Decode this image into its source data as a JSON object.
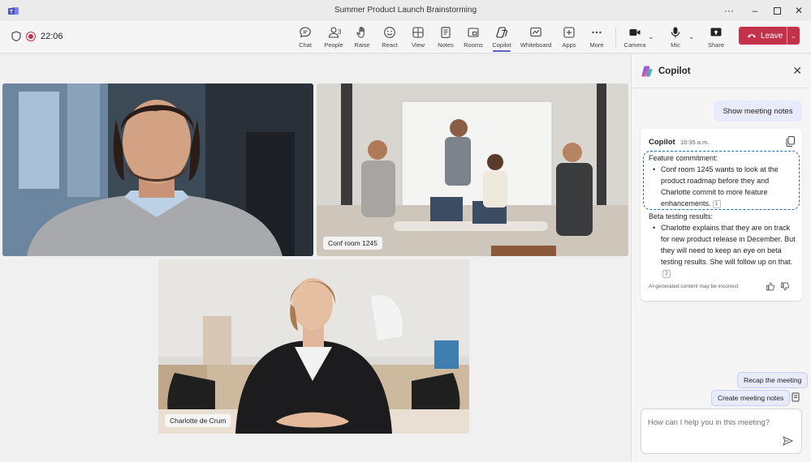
{
  "window": {
    "title": "Summer Product Launch Brainstorming"
  },
  "toolbar": {
    "timer": "22:06",
    "people_count": "3",
    "items": {
      "chat": "Chat",
      "people": "People",
      "raise": "Raise",
      "react": "React",
      "view": "View",
      "notes": "Notes",
      "rooms": "Rooms",
      "copilot": "Copilot",
      "whiteboard": "Whiteboard",
      "apps": "Apps",
      "more": "More",
      "camera": "Camera",
      "mic": "Mic",
      "share": "Share"
    },
    "leave_label": "Leave",
    "accent": "#5b5fc7",
    "leave_color": "#c4314b"
  },
  "stage": {
    "tiles": [
      {
        "id": "participant-man",
        "label": ""
      },
      {
        "id": "conf-room",
        "label": "Conf room 1245"
      },
      {
        "id": "charlotte",
        "label": "Charlotte de Crum"
      }
    ]
  },
  "copilot": {
    "title": "Copilot",
    "user_prompt": "Show meeting notes",
    "response": {
      "author": "Copilot",
      "time": "10:35 a.m.",
      "section1_title": "Feature commitment:",
      "section1_bullet": "Conf room 1245 wants to look at the product roadmap before they and Charlotte commit to more feature enhancements.",
      "section1_ref": "1",
      "section2_title": "Beta testing results:",
      "section2_bullet": "Charlotte explains that they are on track for new product release in December. But they will need to keep an eye on beta testing results. She will follow up on that.",
      "section2_ref": "2",
      "disclaimer": "AI-generated content may be incorrect"
    },
    "suggestions": {
      "recap": "Recap the meeting",
      "create_notes": "Create meeting notes"
    },
    "input_placeholder": "How can I help you in this meeting?"
  }
}
